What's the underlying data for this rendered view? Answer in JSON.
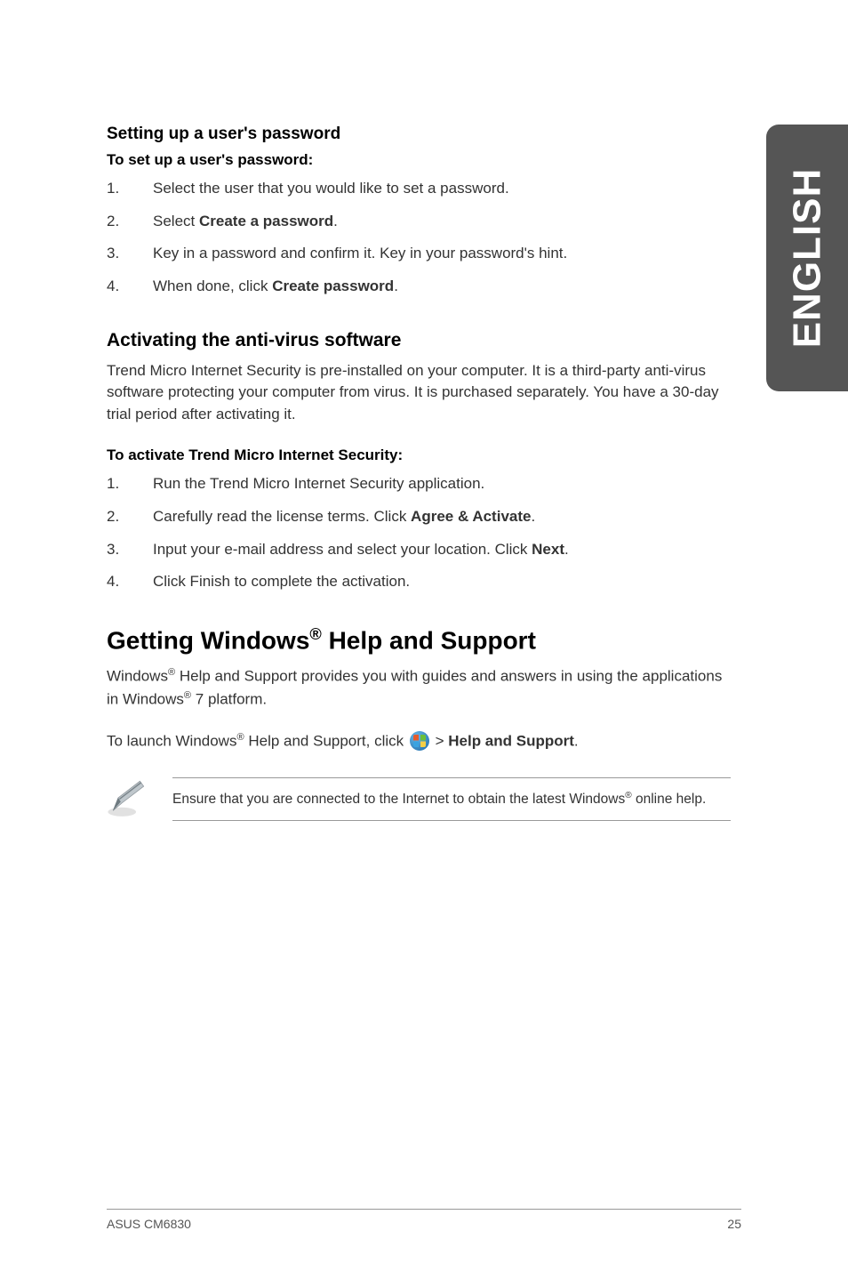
{
  "side_tab": "ENGLISH",
  "sec1": {
    "title": "Setting up a user's password",
    "subtitle": "To set up a user's password:",
    "steps": [
      {
        "num": "1.",
        "text_before": "Select the user that you would like to set a password.",
        "bold": "",
        "text_after": ""
      },
      {
        "num": "2.",
        "text_before": "Select ",
        "bold": "Create a password",
        "text_after": "."
      },
      {
        "num": "3.",
        "text_before": "Key in a password and confirm it. Key in your password's hint.",
        "bold": "",
        "text_after": ""
      },
      {
        "num": "4.",
        "text_before": "When done, click ",
        "bold": "Create password",
        "text_after": "."
      }
    ]
  },
  "sec2": {
    "title": "Activating the anti-virus software",
    "intro": "Trend Micro Internet Security is pre-installed on your computer. It is a third-party anti-virus software protecting your computer from virus. It is purchased separately. You have a 30-day trial period after activating it.",
    "subtitle": "To activate Trend Micro Internet Security:",
    "steps": [
      {
        "num": "1.",
        "text_before": "Run the Trend Micro Internet Security application.",
        "bold": "",
        "text_after": ""
      },
      {
        "num": "2.",
        "text_before": "Carefully read the license terms. Click ",
        "bold": "Agree & Activate",
        "text_after": "."
      },
      {
        "num": "3.",
        "text_before": "Input your e-mail address and select your location. Click ",
        "bold": "Next",
        "text_after": "."
      },
      {
        "num": "4.",
        "text_before": "Click Finish to complete the activation.",
        "bold": "",
        "text_after": ""
      }
    ]
  },
  "sec3": {
    "title_a": "Getting Windows",
    "title_b": " Help and Support",
    "p1_a": "Windows",
    "p1_b": " Help and Support provides you with guides and answers in using the applications in Windows",
    "p1_c": " 7 platform.",
    "p2_a": "To launch Windows",
    "p2_b": " Help and Support, click ",
    "p2_c": " > ",
    "p2_bold": "Help and Support",
    "p2_d": ".",
    "note_a": "Ensure that you are connected to the Internet to obtain the latest Windows",
    "note_b": " online help."
  },
  "footer": {
    "left": "ASUS CM6830",
    "right": "25"
  }
}
